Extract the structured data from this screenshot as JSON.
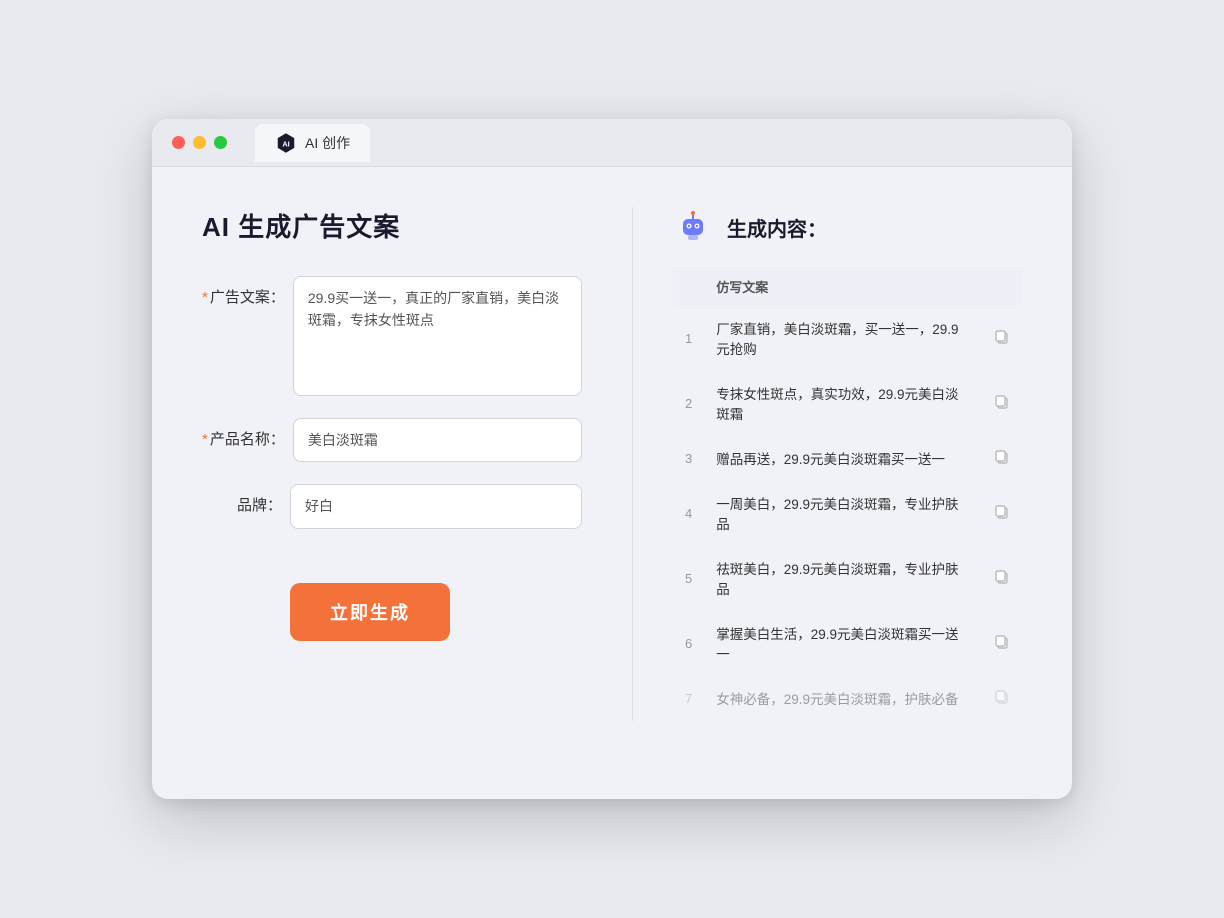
{
  "browser": {
    "tab_label": "AI 创作",
    "traffic_lights": [
      "red",
      "yellow",
      "green"
    ]
  },
  "page": {
    "title": "AI 生成广告文案",
    "form": {
      "ad_copy_label": "广告文案：",
      "ad_copy_required": true,
      "ad_copy_value": "29.9买一送一，真正的厂家直销，美白淡斑霜，专抹女性斑点",
      "product_name_label": "产品名称：",
      "product_name_required": true,
      "product_name_value": "美白淡斑霜",
      "brand_label": "品牌：",
      "brand_required": false,
      "brand_value": "好白",
      "generate_button": "立即生成"
    },
    "result": {
      "header_title": "生成内容：",
      "table_header": "仿写文案",
      "items": [
        {
          "num": 1,
          "text": "厂家直销，美白淡斑霜，买一送一，29.9元抢购"
        },
        {
          "num": 2,
          "text": "专抹女性斑点，真实功效，29.9元美白淡斑霜"
        },
        {
          "num": 3,
          "text": "赠品再送，29.9元美白淡斑霜买一送一"
        },
        {
          "num": 4,
          "text": "一周美白，29.9元美白淡斑霜，专业护肤品"
        },
        {
          "num": 5,
          "text": "祛斑美白，29.9元美白淡斑霜，专业护肤品"
        },
        {
          "num": 6,
          "text": "掌握美白生活，29.9元美白淡斑霜买一送一"
        },
        {
          "num": 7,
          "text": "女神必备，29.9元美白淡斑霜，护肤必备"
        }
      ]
    }
  }
}
